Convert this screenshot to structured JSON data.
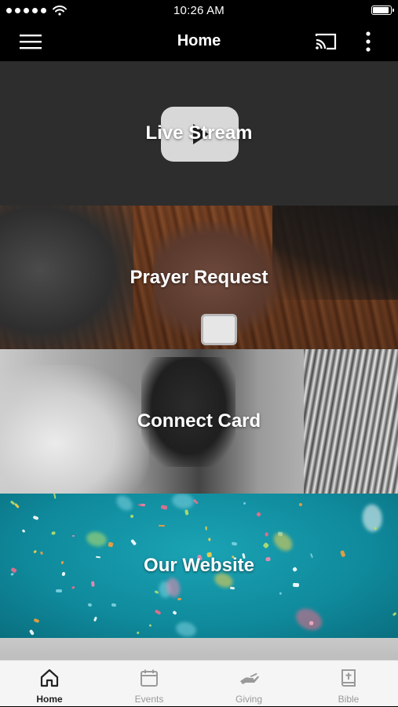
{
  "status_bar": {
    "time": "10:26 AM",
    "signal_dots": 5,
    "battery_level": 1.0
  },
  "nav": {
    "title": "Home",
    "menu_icon": "hamburger-menu-icon",
    "cast_icon": "cast-icon",
    "more_icon": "more-vertical-icon"
  },
  "tiles": [
    {
      "label": "Live Stream",
      "icon": "youtube-play-icon"
    },
    {
      "label": "Prayer Request"
    },
    {
      "label": "Connect Card"
    },
    {
      "label": "Our Website"
    }
  ],
  "tab_bar": {
    "items": [
      {
        "label": "Home",
        "icon": "home-icon",
        "active": true
      },
      {
        "label": "Events",
        "icon": "calendar-icon",
        "active": false
      },
      {
        "label": "Giving",
        "icon": "giving-hand-icon",
        "active": false
      },
      {
        "label": "Bible",
        "icon": "bible-icon",
        "active": false
      }
    ]
  },
  "colors": {
    "header_bg": "#000000",
    "website_tile": "#1aa3b4",
    "tab_active": "#222222",
    "tab_inactive": "#9a9a9a"
  }
}
